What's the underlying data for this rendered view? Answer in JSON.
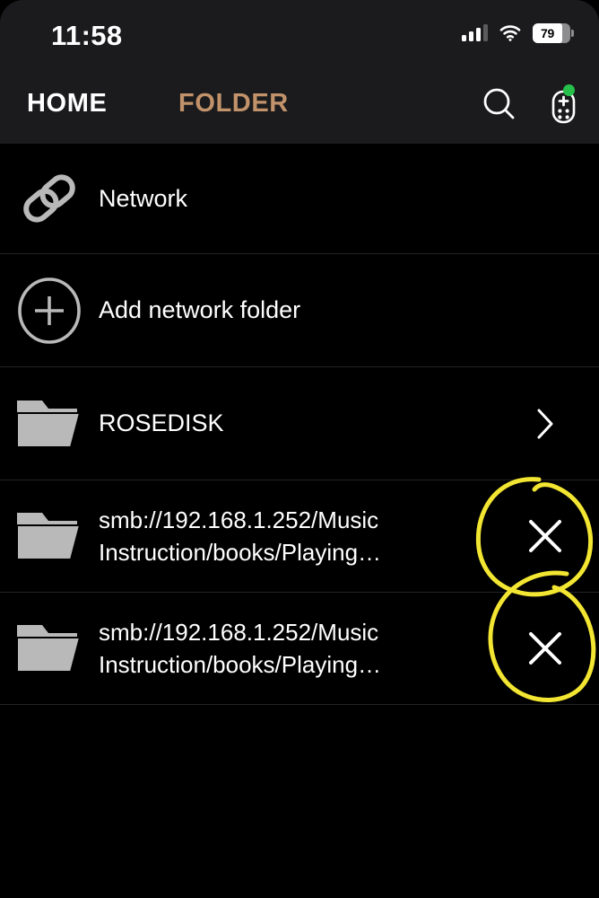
{
  "status_bar": {
    "time": "11:58",
    "cellular_icon": "cellular-signal-icon",
    "wifi_icon": "wifi-icon",
    "battery_level": "79",
    "battery_icon": "battery-icon"
  },
  "nav": {
    "tabs": [
      {
        "label": "HOME",
        "active": false,
        "color": "#ffffff"
      },
      {
        "label": "FOLDER",
        "active": true,
        "color": "#c2926a"
      }
    ],
    "search_icon": "search-icon",
    "remote_icon": "remote-control-icon",
    "status_dot_color": "#26c04a"
  },
  "list": {
    "items": [
      {
        "label": "Network",
        "icon": "link-chain-icon",
        "trailing": "none"
      },
      {
        "label": "Add network folder",
        "icon": "plus-circle-icon",
        "trailing": "none"
      },
      {
        "label": "ROSEDISK",
        "icon": "folder-icon",
        "trailing": "chevron-right-icon"
      },
      {
        "label": "smb://192.168.1.252/Music Instruction/books/Playing…",
        "icon": "folder-icon",
        "trailing": "close-x-icon"
      },
      {
        "label": "smb://192.168.1.252/Music Instruction/books/Playing…",
        "icon": "folder-icon",
        "trailing": "close-x-icon"
      }
    ]
  },
  "annotations": {
    "color": "#f2e632",
    "marks": [
      {
        "shape": "hand-drawn-circle",
        "target": "remove-button-row-4"
      },
      {
        "shape": "hand-drawn-circle",
        "target": "remove-button-row-5"
      }
    ]
  },
  "theme": {
    "header_bg": "#1b1b1d",
    "body_bg": "#000000",
    "separator": "#232325",
    "icon_gray": "#b9b9b9",
    "text": "#ffffff"
  }
}
